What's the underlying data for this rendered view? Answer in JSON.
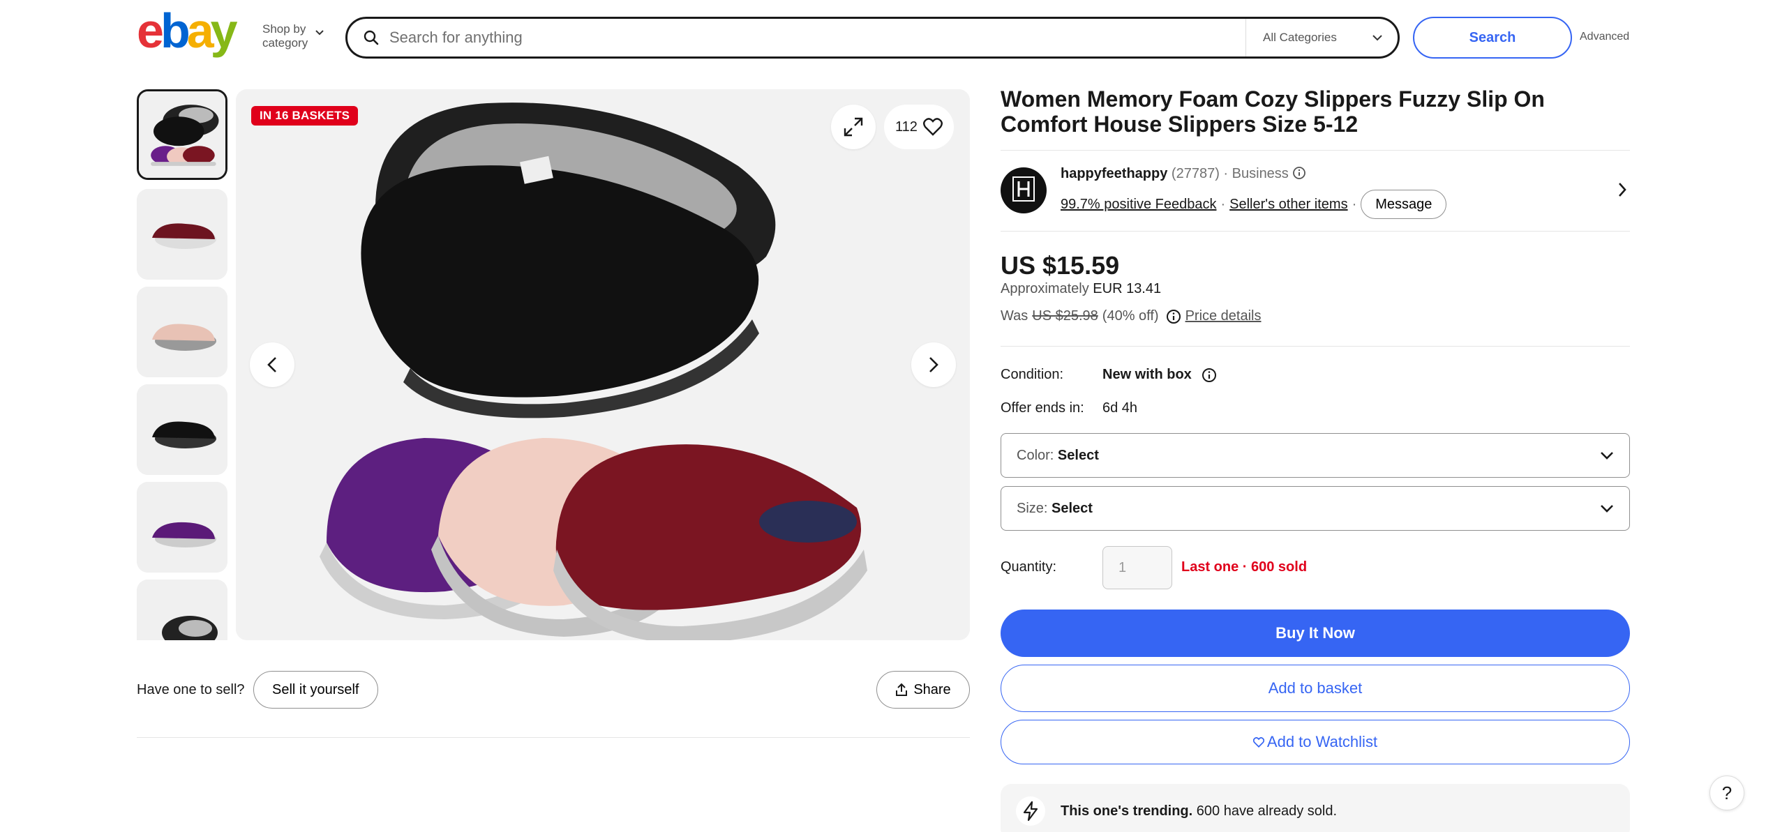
{
  "header": {
    "logo_text": "ebay",
    "shop_by_line1": "Shop by",
    "shop_by_line2": "category",
    "search_placeholder": "Search for anything",
    "category_selected": "All Categories",
    "search_button": "Search",
    "advanced_link": "Advanced"
  },
  "gallery": {
    "badge": "IN 16 BASKETS",
    "watch_count": "112",
    "thumbnails": [
      {
        "icon": "multi-color-slippers"
      },
      {
        "icon": "burgundy-slipper"
      },
      {
        "icon": "pink-slipper"
      },
      {
        "icon": "black-slipper"
      },
      {
        "icon": "purple-slipper"
      },
      {
        "icon": "black-slipper-partial"
      }
    ]
  },
  "sell": {
    "prompt": "Have one to sell?",
    "button": "Sell it yourself",
    "share": "Share"
  },
  "product": {
    "title": "Women Memory Foam Cozy Slippers Fuzzy Slip On Comfort House Slippers Size 5-12"
  },
  "seller": {
    "name": "happyfeethappy",
    "feedback_count": "(27787)",
    "separator": "·",
    "type": "Business",
    "feedback_link": "99.7% positive Feedback",
    "other_items_link": "Seller's other items",
    "message_button": "Message"
  },
  "pricing": {
    "price": "US $15.59",
    "approx_label": "Approximately",
    "approx_value": "EUR 13.41",
    "was_label": "Was",
    "was_price": "US $25.98",
    "discount": "(40% off)",
    "price_details": "Price details"
  },
  "details": {
    "condition_label": "Condition:",
    "condition_value": "New with box",
    "offer_label": "Offer ends in:",
    "offer_value": "6d 4h"
  },
  "variations": {
    "color_label": "Color:",
    "color_value": "Select",
    "size_label": "Size:",
    "size_value": "Select"
  },
  "quantity": {
    "label": "Quantity:",
    "value": "1",
    "status": "Last one · 600 sold"
  },
  "actions": {
    "buy_now": "Buy It Now",
    "add_basket": "Add to basket",
    "add_watchlist": "Add to Watchlist"
  },
  "trending": {
    "headline": "This one's trending.",
    "detail": "600 have already sold."
  },
  "help": {
    "label": "?"
  },
  "colors": {
    "primary_blue": "#3665f3",
    "alert_red": "#e0001b",
    "text": "#191919"
  }
}
